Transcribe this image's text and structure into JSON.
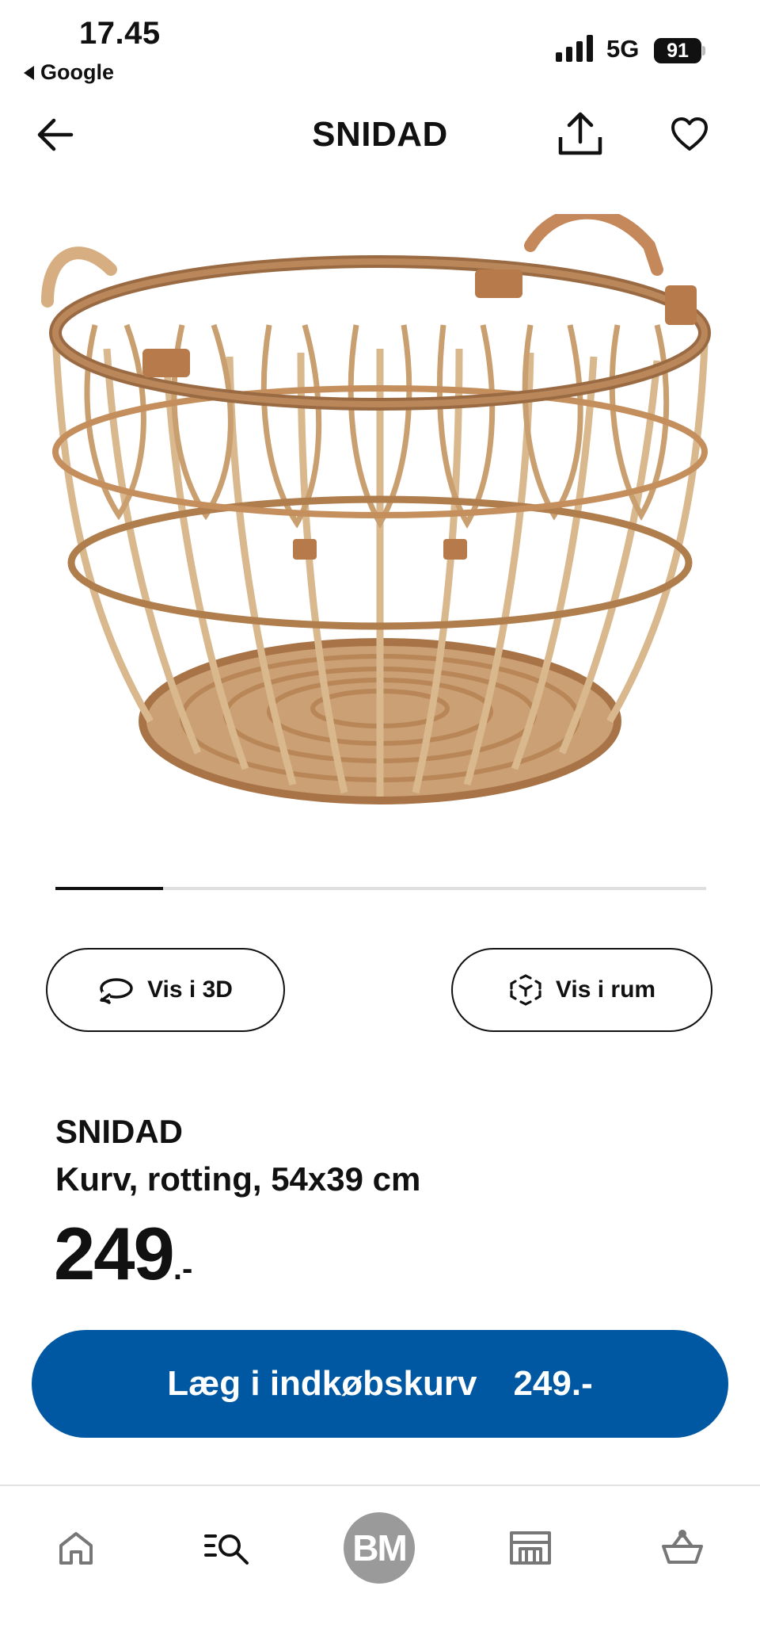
{
  "status_bar": {
    "time": "17.45",
    "back_app": "Google",
    "network": "5G",
    "battery": "91"
  },
  "header": {
    "title": "SNIDAD",
    "icons": [
      "back-arrow-icon",
      "share-icon",
      "heart-icon"
    ]
  },
  "gallery": {
    "image_name": "rattan-basket-image",
    "progress_fraction": 0.165
  },
  "actions": {
    "view_3d_label": "Vis i 3D",
    "view_room_label": "Vis i rum"
  },
  "product": {
    "name": "SNIDAD",
    "description": "Kurv, rotting, 54x39 cm",
    "price_main": "249",
    "price_suffix": ".-"
  },
  "cart_button": {
    "label": "Læg i indkøbskurv",
    "price": "249.-",
    "color": "#0058a3"
  },
  "bottom_nav": {
    "items": [
      "home-icon",
      "search-icon",
      "avatar",
      "store-icon",
      "cart-icon"
    ],
    "avatar_initials": "BM"
  }
}
